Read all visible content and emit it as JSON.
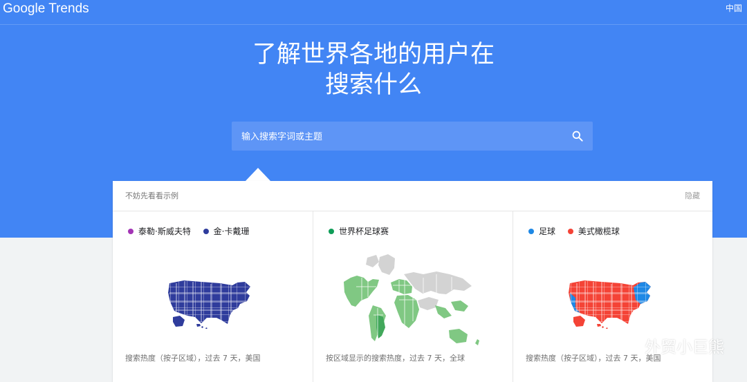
{
  "header": {
    "logo_text": "Google Trends",
    "region_label": "中国"
  },
  "hero": {
    "title_line_1": "了解世界各地的用户在",
    "title_line_2": "搜索什么"
  },
  "search": {
    "placeholder": "输入搜索字词或主题",
    "icon": "search-icon"
  },
  "examples": {
    "title": "不妨先看看示例",
    "hide_label": "隐藏",
    "cards": [
      {
        "legend": [
          {
            "label": "泰勒·斯威夫特",
            "color": "#a334b5"
          },
          {
            "label": "金·卡戴珊",
            "color": "#2f3c9c"
          }
        ],
        "footer": "搜索热度（按子区域），过去 7 天，美国"
      },
      {
        "legend": [
          {
            "label": "世界杯足球赛",
            "color": "#0f9d58"
          }
        ],
        "footer": "按区域显示的搜索热度，过去 7 天，全球"
      },
      {
        "legend": [
          {
            "label": "足球",
            "color": "#1e88e5"
          },
          {
            "label": "美式橄榄球",
            "color": "#f44336"
          }
        ],
        "footer": "搜索热度（按子区域），过去 7 天，美国"
      }
    ]
  },
  "watermark": {
    "text": "外贸小巨熊",
    "icon": "wechat-icon"
  },
  "colors": {
    "brand_blue": "#4285f4",
    "search_box": "#5e95f6",
    "panel_bg": "#ffffff",
    "page_bg": "#f1f3f4"
  }
}
